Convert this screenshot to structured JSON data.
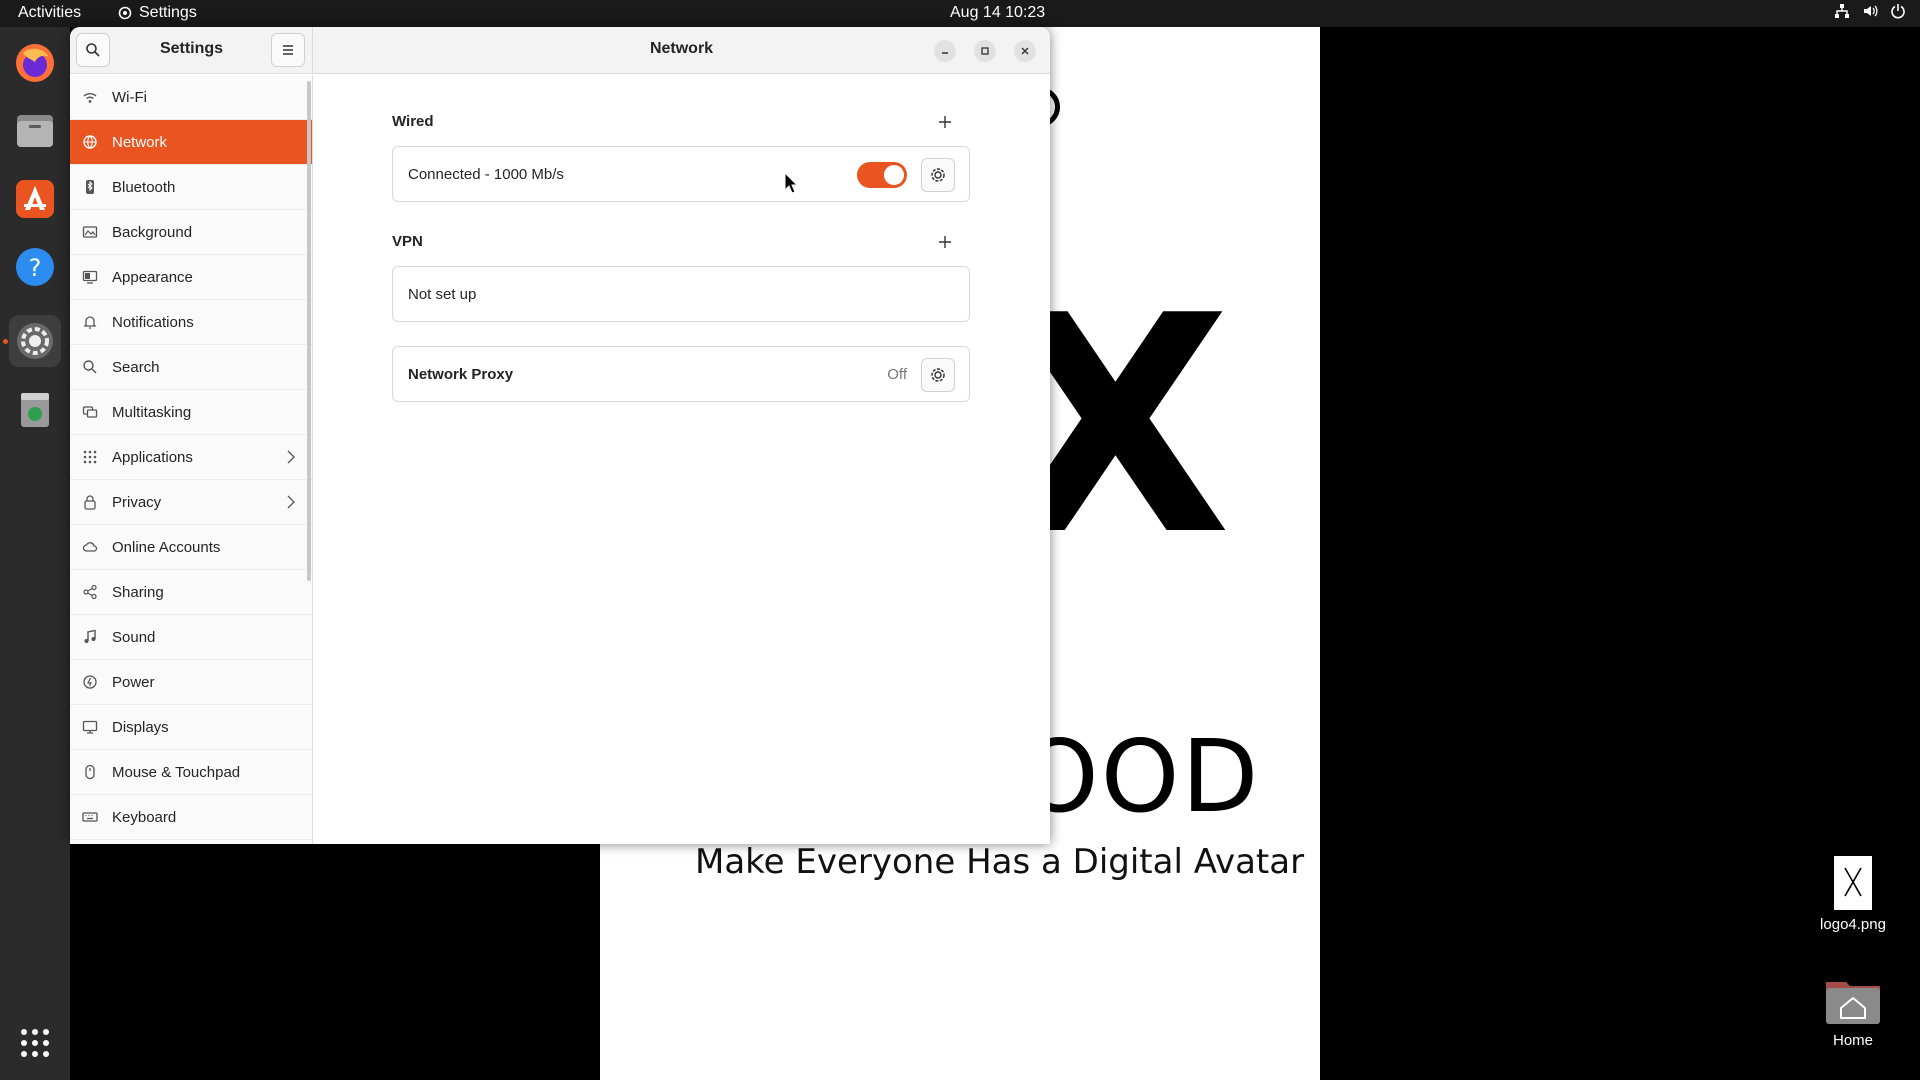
{
  "topbar": {
    "activities": "Activities",
    "app_name": "Settings",
    "clock": "Aug 14  10:23"
  },
  "desktop": {
    "wallpaper_tagline": "Make Everyone Has a Digital Avatar",
    "wallpaper_letter": "X",
    "wallpaper_word": "OOD",
    "icons": [
      {
        "label": "logo4.png"
      },
      {
        "label": "Home"
      }
    ]
  },
  "window": {
    "sidebar_title": "Settings",
    "page_title": "Network"
  },
  "sidebar": {
    "items": [
      {
        "label": "Wi-Fi",
        "icon": "wifi-icon"
      },
      {
        "label": "Network",
        "icon": "network-icon",
        "selected": true
      },
      {
        "label": "Bluetooth",
        "icon": "bluetooth-icon"
      },
      {
        "label": "Background",
        "icon": "background-icon"
      },
      {
        "label": "Appearance",
        "icon": "appearance-icon"
      },
      {
        "label": "Notifications",
        "icon": "bell-icon"
      },
      {
        "label": "Search",
        "icon": "search-icon"
      },
      {
        "label": "Multitasking",
        "icon": "multitasking-icon"
      },
      {
        "label": "Applications",
        "icon": "apps-grid-icon",
        "has_submenu": true
      },
      {
        "label": "Privacy",
        "icon": "lock-icon",
        "has_submenu": true
      },
      {
        "label": "Online Accounts",
        "icon": "cloud-icon"
      },
      {
        "label": "Sharing",
        "icon": "share-icon"
      },
      {
        "label": "Sound",
        "icon": "music-note-icon"
      },
      {
        "label": "Power",
        "icon": "power-icon"
      },
      {
        "label": "Displays",
        "icon": "display-icon"
      },
      {
        "label": "Mouse & Touchpad",
        "icon": "mouse-icon"
      },
      {
        "label": "Keyboard",
        "icon": "keyboard-icon"
      }
    ]
  },
  "network": {
    "wired": {
      "title": "Wired",
      "status": "Connected - 1000 Mb/s",
      "enabled": true
    },
    "vpn": {
      "title": "VPN",
      "status": "Not set up"
    },
    "proxy": {
      "title": "Network Proxy",
      "status": "Off"
    }
  },
  "colors": {
    "accent": "#e95420",
    "topbar": "#1a1a1a",
    "dock": "#2b2b2b"
  }
}
